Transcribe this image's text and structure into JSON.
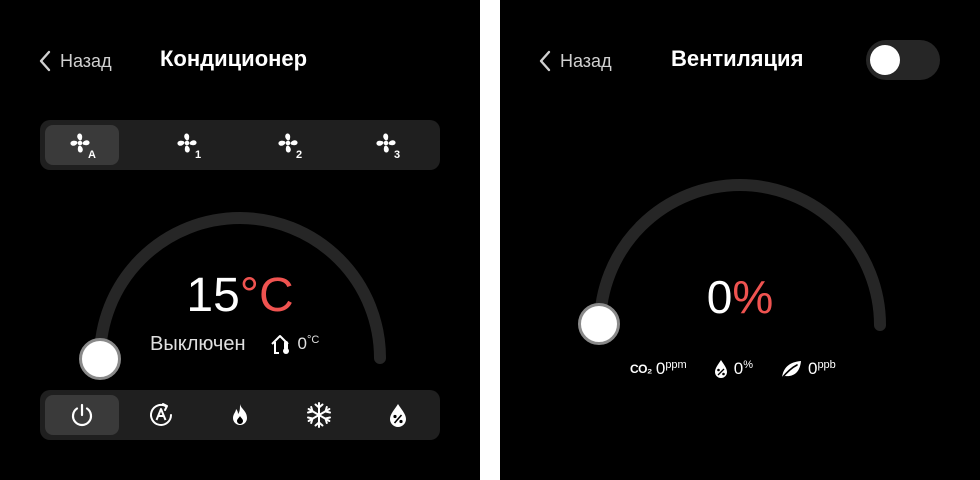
{
  "conditioner": {
    "back_label": "Назад",
    "title": "Кондиционер",
    "fan_modes": [
      {
        "label": "A",
        "icon": "fan-auto-icon",
        "selected": true
      },
      {
        "label": "1",
        "icon": "fan-speed-1-icon",
        "selected": false
      },
      {
        "label": "2",
        "icon": "fan-speed-2-icon",
        "selected": false
      },
      {
        "label": "3",
        "icon": "fan-speed-3-icon",
        "selected": false
      }
    ],
    "temperature_value": "15",
    "temperature_unit": "°C",
    "status": "Выключен",
    "outdoor_temp_value": "0",
    "outdoor_temp_unit": "°C",
    "modes": [
      {
        "icon": "power-icon",
        "selected": true
      },
      {
        "icon": "auto-mode-icon",
        "selected": false
      },
      {
        "icon": "heat-icon",
        "selected": false
      },
      {
        "icon": "cool-icon",
        "selected": false
      },
      {
        "icon": "dry-icon",
        "selected": false
      }
    ],
    "accent_color": "#ef5350"
  },
  "ventilation": {
    "back_label": "Назад",
    "title": "Вентиляция",
    "enabled": false,
    "level_value": "0",
    "level_unit": "%",
    "level_fraction": 0,
    "sensors": {
      "co2_label": "CO₂",
      "co2_value": "0",
      "co2_unit": "ppm",
      "humidity_value": "0",
      "humidity_unit": "%",
      "voc_value": "0",
      "voc_unit": "ppb"
    },
    "accent_color": "#ef5350"
  }
}
